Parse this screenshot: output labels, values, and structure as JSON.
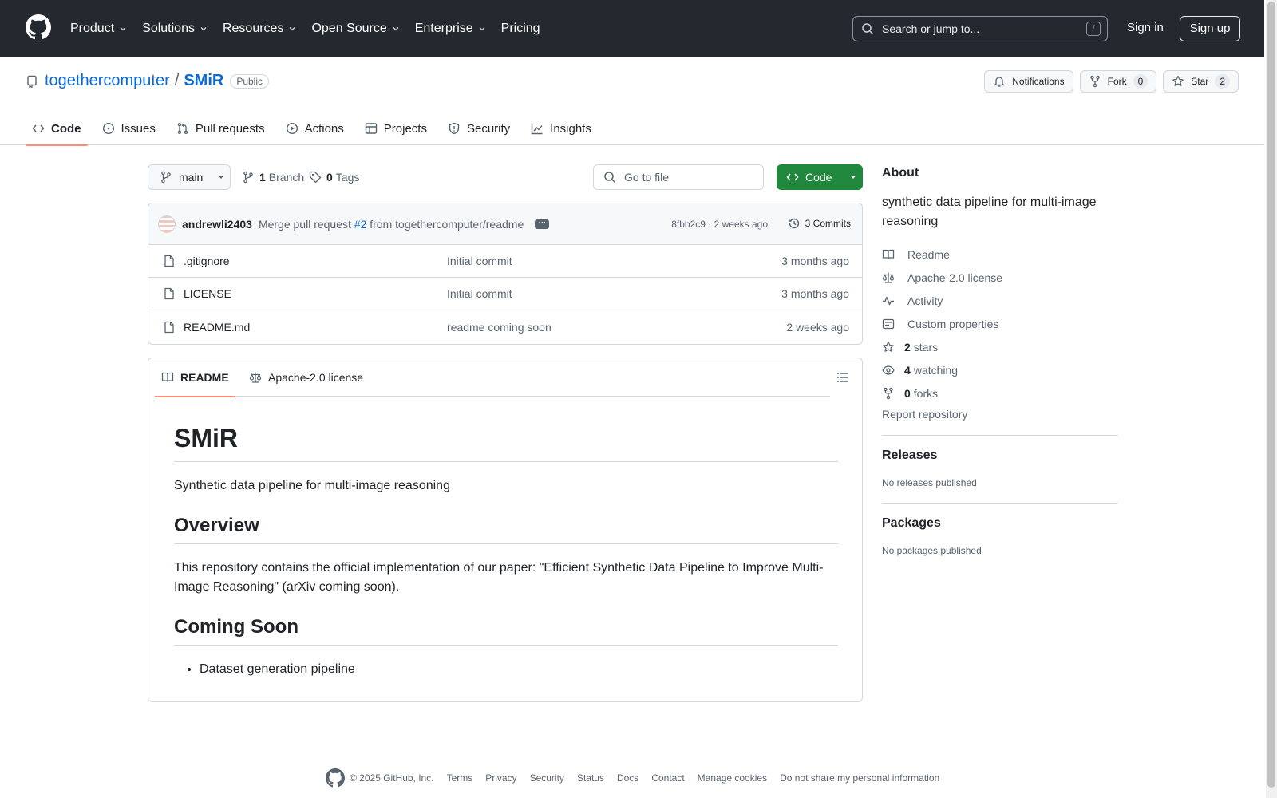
{
  "header": {
    "nav": [
      {
        "label": "Product",
        "has_menu": true
      },
      {
        "label": "Solutions",
        "has_menu": true
      },
      {
        "label": "Resources",
        "has_menu": true
      },
      {
        "label": "Open Source",
        "has_menu": true
      },
      {
        "label": "Enterprise",
        "has_menu": true
      },
      {
        "label": "Pricing",
        "has_menu": false
      }
    ],
    "search_placeholder": "Search or jump to...",
    "search_shortcut": "/",
    "sign_in": "Sign in",
    "sign_up": "Sign up"
  },
  "repo": {
    "owner": "togethercomputer",
    "separator": "/",
    "name": "SMiR",
    "visibility": "Public",
    "actions": {
      "notifications": "Notifications",
      "fork": "Fork",
      "fork_count": "0",
      "star": "Star",
      "star_count": "2"
    },
    "tabs": [
      {
        "label": "Code",
        "icon": "code-icon",
        "active": true
      },
      {
        "label": "Issues",
        "icon": "issue-icon",
        "active": false
      },
      {
        "label": "Pull requests",
        "icon": "pull-request-icon",
        "active": false
      },
      {
        "label": "Actions",
        "icon": "play-icon",
        "active": false
      },
      {
        "label": "Projects",
        "icon": "table-icon",
        "active": false
      },
      {
        "label": "Security",
        "icon": "shield-icon",
        "active": false
      },
      {
        "label": "Insights",
        "icon": "graph-icon",
        "active": false
      }
    ]
  },
  "branch_bar": {
    "branch": "main",
    "branch_count": "1",
    "branch_label": "Branch",
    "tag_count": "0",
    "tag_label": "Tags",
    "goto_placeholder": "Go to file",
    "code_button": "Code"
  },
  "latest_commit": {
    "author": "andrewli2403",
    "message_prefix": "Merge pull request",
    "pr_ref": "#2",
    "message_suffix": "from togethercomputer/readme",
    "hash_and_time": "8fbb2c9 · 2 weeks ago",
    "commits_label": "3 Commits"
  },
  "files": [
    {
      "name": ".gitignore",
      "message": "Initial commit",
      "date": "3 months ago"
    },
    {
      "name": "LICENSE",
      "message": "Initial commit",
      "date": "3 months ago"
    },
    {
      "name": "README.md",
      "message": "readme coming soon",
      "date": "2 weeks ago"
    }
  ],
  "readme": {
    "tabs": [
      {
        "label": "README",
        "active": true
      },
      {
        "label": "Apache-2.0 license",
        "active": false
      }
    ],
    "title": "SMiR",
    "intro": "Synthetic data pipeline for multi-image reasoning",
    "overview_heading": "Overview",
    "overview_text": "This repository contains the official implementation of our paper: \"Efficient Synthetic Data Pipeline to Improve Multi-Image Reasoning\" (arXiv coming soon).",
    "coming_heading": "Coming Soon",
    "coming_items": [
      "Dataset generation pipeline"
    ]
  },
  "sidebar": {
    "about_title": "About",
    "description": "synthetic data pipeline for multi-image reasoning",
    "items": [
      {
        "icon": "book-icon",
        "count": "",
        "label": "Readme"
      },
      {
        "icon": "law-icon",
        "count": "",
        "label": "Apache-2.0 license"
      },
      {
        "icon": "pulse-icon",
        "count": "",
        "label": "Activity"
      },
      {
        "icon": "note-icon",
        "count": "",
        "label": "Custom properties"
      },
      {
        "icon": "star-icon",
        "count": "2",
        "label": "stars"
      },
      {
        "icon": "eye-icon",
        "count": "4",
        "label": "watching"
      },
      {
        "icon": "fork-icon",
        "count": "0",
        "label": "forks"
      }
    ],
    "report": "Report repository",
    "releases_title": "Releases",
    "releases_empty": "No releases published",
    "packages_title": "Packages",
    "packages_empty": "No packages published"
  },
  "footer": {
    "copyright": "© 2025 GitHub, Inc.",
    "links": [
      "Terms",
      "Privacy",
      "Security",
      "Status",
      "Docs",
      "Contact",
      "Manage cookies",
      "Do not share my personal information"
    ]
  },
  "colors": {
    "header_bg": "#24292f",
    "link": "#0969da",
    "code_button": "#1f883d",
    "active_tab_underline": "#fd8c73"
  }
}
